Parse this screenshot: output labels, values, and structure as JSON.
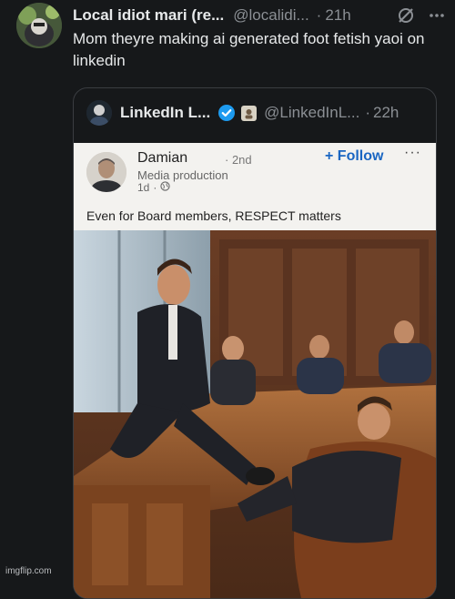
{
  "post": {
    "display_name": "Local idiot mari (re...",
    "handle": "@localidi...",
    "separator": "·",
    "time": "21h",
    "text": "Mom theyre making ai generated foot fetish yaoi on linkedin"
  },
  "quote": {
    "display_name": "LinkedIn L...",
    "handle": "@LinkedInL...",
    "separator": "·",
    "time": "22h",
    "verified_color": "#1d9bf0"
  },
  "linkedin_post": {
    "author": "Damian",
    "degree": "· 2nd",
    "headline": "Media production",
    "age": "1d",
    "separator": "·",
    "follow_label": "+ Follow",
    "more_label": "···",
    "text": "Even for Board members, RESPECT matters",
    "accent_color": "#1a66c2"
  },
  "watermark": "imgflip.com",
  "icons": [
    "avatar-image",
    "grok-icon",
    "more-icon",
    "verified-badge-icon",
    "globe-icon"
  ]
}
